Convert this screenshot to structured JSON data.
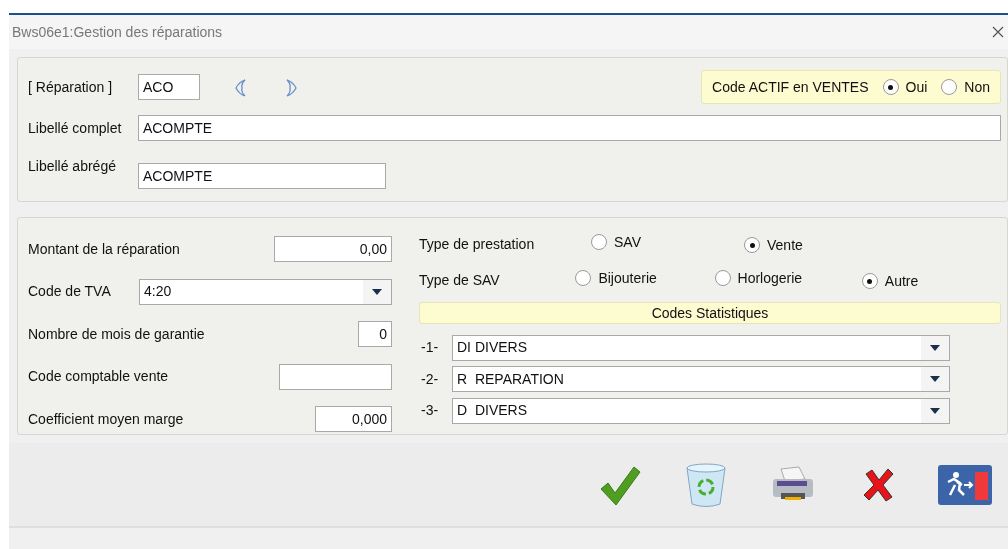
{
  "window": {
    "title": "Bws06e1:Gestion des réparations"
  },
  "header": {
    "code_label": "[ Réparation ]",
    "code": "ACO",
    "active": {
      "label": "Code ACTIF en VENTES",
      "options": [
        {
          "label": "Oui",
          "selected": true
        },
        {
          "label": "Non",
          "selected": false
        }
      ]
    },
    "fields": [
      {
        "label": "Libellé complet",
        "value": "ACOMPTE",
        "kind": "wide"
      },
      {
        "label": "Libellé abrégé",
        "value": "ACOMPTE",
        "kind": "medium"
      }
    ]
  },
  "details": {
    "fields": [
      {
        "kind": "amount",
        "label": "Montant de la réparation",
        "value": "0,00"
      },
      {
        "kind": "select",
        "label": "Code de TVA",
        "value": "4:20"
      },
      {
        "kind": "short",
        "label": "Nombre de mois de garantie",
        "value": "0"
      },
      {
        "kind": "text",
        "label": "Code comptable vente"
      },
      {
        "kind": "coef",
        "label": "Coefficient moyen marge",
        "value": "0,000"
      }
    ],
    "prestation": {
      "label": "Type de prestation",
      "options": [
        {
          "label": "SAV",
          "selected": false
        },
        {
          "label": "Vente",
          "selected": true
        }
      ]
    },
    "sav": {
      "label": "Type de SAV",
      "options": [
        {
          "label": "Bijouterie",
          "selected": false
        },
        {
          "label": "Horlogerie",
          "selected": false
        },
        {
          "label": "Autre",
          "selected": true
        }
      ]
    },
    "stats": {
      "title": "Codes Statistiques",
      "rows": [
        {
          "index": "-1-",
          "value": "DI DIVERS"
        },
        {
          "index": "-2-",
          "value": "R  REPARATION"
        },
        {
          "index": "-3-",
          "value": "D  DIVERS"
        }
      ]
    }
  }
}
